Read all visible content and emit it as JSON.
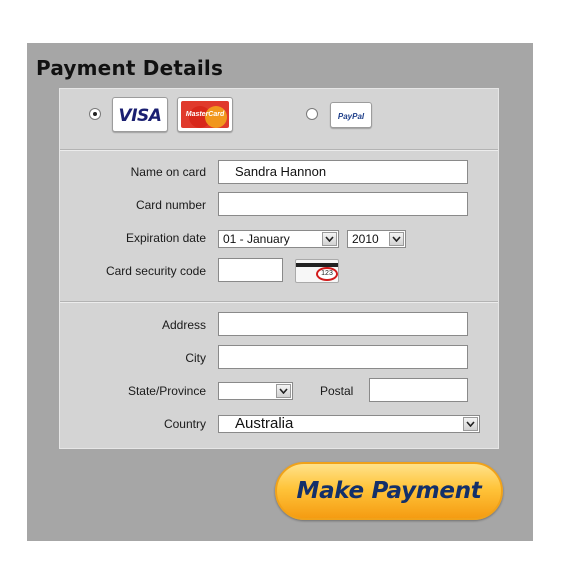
{
  "title": "Payment Details",
  "payment_methods": [
    {
      "name": "Visa",
      "label": "VISA",
      "selected": true
    },
    {
      "name": "MasterCard",
      "label": "MasterCard",
      "selected": true
    },
    {
      "name": "PayPal",
      "label": "PayPal",
      "selected": false
    }
  ],
  "card": {
    "name_label": "Name on card",
    "name_value": "Sandra Hannon",
    "number_label": "Card number",
    "number_value": "",
    "expiration_label": "Expiration date",
    "exp_month": "01 - January",
    "exp_year": "2010",
    "security_label": "Card security code",
    "security_value": "",
    "cvv_hint": "123"
  },
  "address": {
    "address_label": "Address",
    "address_value": "",
    "city_label": "City",
    "city_value": "",
    "state_label": "State/Province",
    "state_value": "",
    "postal_label": "Postal",
    "postal_value": "",
    "country_label": "Country",
    "country_value": "Australia"
  },
  "submit_label": "Make Payment",
  "colors": {
    "panel": "#a6a6a6",
    "form": "#d4d4d4",
    "button_gradient_top": "#ffe28a",
    "button_gradient_bottom": "#f59c12",
    "button_text": "#13306a"
  }
}
